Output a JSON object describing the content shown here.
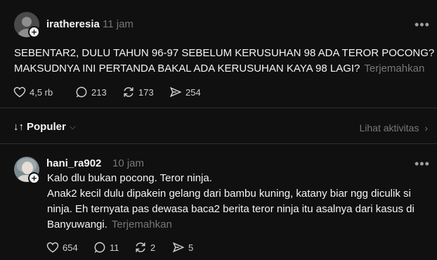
{
  "post": {
    "username": "iratheresia",
    "time": "11 jam",
    "lines": [
      "SEBENTAR2, DULU TAHUN 96-97 SEBELUM KERUSUHAN 98 ADA TEROR POCONG?",
      "MAKSUDNYA INI PERTANDA BAKAL ADA KERUSUHAN KAYA 98 LAGI?"
    ],
    "translate": "Terjemahkan",
    "likes": "4,5 rb",
    "comments": "213",
    "reposts": "173",
    "shares": "254"
  },
  "sort": {
    "label": "Populer",
    "activity": "Lihat aktivitas"
  },
  "reply": {
    "username": "hani_ra902",
    "time": "10 jam",
    "lines": [
      "Kalo dlu bukan pocong. Teror ninja.",
      "Anak2 kecil dulu dipakein gelang dari bambu kuning, katany biar ngg diculik si",
      "ninja. Eh ternyata pas dewasa baca2 berita teror ninja itu asalnya dari kasus di",
      "Banyuwangi."
    ],
    "translate": "Terjemahkan",
    "likes": "654",
    "comments": "11",
    "reposts": "2",
    "shares": "5"
  },
  "icons": {
    "more": "more-horizontal-icon",
    "like": "heart-icon",
    "comment": "comment-bubble-icon",
    "repost": "repost-icon",
    "share": "send-icon",
    "sort": "sort-arrows-icon",
    "chevron_down": "chevron-down-icon",
    "chevron_right": "chevron-right-icon",
    "follow": "plus-icon"
  },
  "colors": {
    "background": "#101010",
    "text": "#f3f5f7",
    "secondary": "#777777",
    "divider": "#2e2e2e"
  }
}
